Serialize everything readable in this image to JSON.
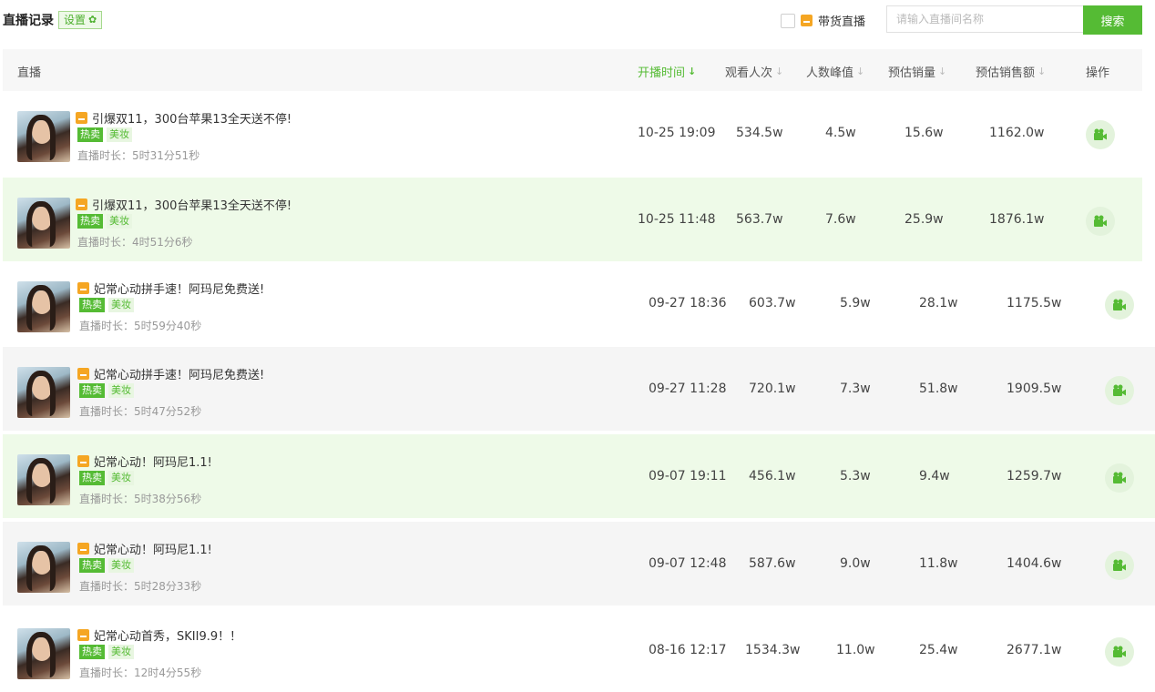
{
  "header": {
    "title": "直播记录",
    "settings_label": "设置",
    "filter_label": "带货直播",
    "search_placeholder": "请输入直播间名称",
    "search_button": "搜索"
  },
  "table": {
    "columns": [
      "直播",
      "开播时间",
      "观看人次",
      "人数峰值",
      "预估销量",
      "预估销售额",
      "操作"
    ],
    "active_sort_column": "开播时间",
    "duration_prefix": "直播时长：",
    "rows": [
      {
        "title": "引爆双11，300台苹果13全天送不停!",
        "tags": [
          "热卖",
          "美妆"
        ],
        "duration": "5时31分51秒",
        "start_time": "10-25 19:09",
        "views": "534.5w",
        "peak": "4.5w",
        "sales_volume": "15.6w",
        "sales_amount": "1162.0w"
      },
      {
        "title": "引爆双11，300台苹果13全天送不停!",
        "tags": [
          "热卖",
          "美妆"
        ],
        "duration": "4时51分6秒",
        "start_time": "10-25 11:48",
        "views": "563.7w",
        "peak": "7.6w",
        "sales_volume": "25.9w",
        "sales_amount": "1876.1w"
      },
      {
        "title": "妃常心动拼手速！阿玛尼免费送!",
        "tags": [
          "热卖",
          "美妆"
        ],
        "duration": "5时59分40秒",
        "start_time": "09-27 18:36",
        "views": "603.7w",
        "peak": "5.9w",
        "sales_volume": "28.1w",
        "sales_amount": "1175.5w"
      },
      {
        "title": "妃常心动拼手速！阿玛尼免费送!",
        "tags": [
          "热卖",
          "美妆"
        ],
        "duration": "5时47分52秒",
        "start_time": "09-27 11:28",
        "views": "720.1w",
        "peak": "7.3w",
        "sales_volume": "51.8w",
        "sales_amount": "1909.5w"
      },
      {
        "title": "妃常心动！阿玛尼1.1!",
        "tags": [
          "热卖",
          "美妆"
        ],
        "duration": "5时38分56秒",
        "start_time": "09-07 19:11",
        "views": "456.1w",
        "peak": "5.3w",
        "sales_volume": "9.4w",
        "sales_amount": "1259.7w"
      },
      {
        "title": "妃常心动！阿玛尼1.1!",
        "tags": [
          "热卖",
          "美妆"
        ],
        "duration": "5时28分33秒",
        "start_time": "09-07 12:48",
        "views": "587.6w",
        "peak": "9.0w",
        "sales_volume": "11.8w",
        "sales_amount": "1404.6w"
      },
      {
        "title": "妃常心动首秀，SKII9.9！！",
        "tags": [
          "热卖",
          "美妆"
        ],
        "duration": "12时4分55秒",
        "start_time": "08-16 12:17",
        "views": "1534.3w",
        "peak": "11.0w",
        "sales_volume": "25.4w",
        "sales_amount": "2677.1w"
      }
    ]
  },
  "colors": {
    "accent": "#55bb34",
    "row_highlight": "#eefae8",
    "row_gray": "#f5f5f5",
    "cart_icon": "#f5a623"
  },
  "icons": {
    "settings": "gear-icon",
    "cart": "shopping-cart-icon",
    "action": "video-camera-icon"
  }
}
